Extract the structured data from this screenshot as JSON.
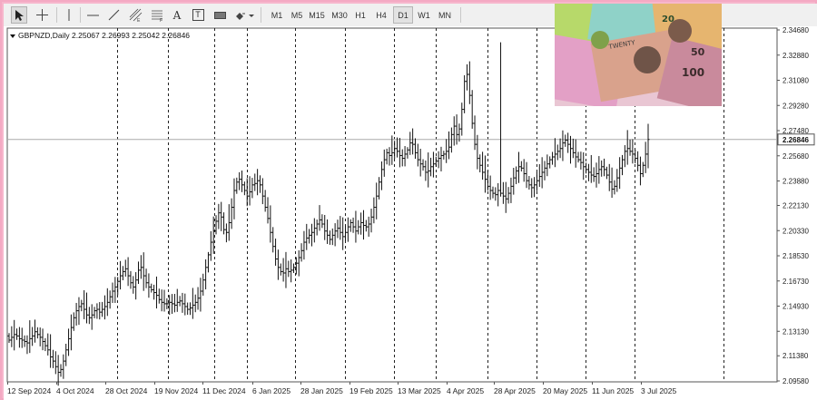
{
  "toolbar": {
    "tools": [
      {
        "name": "cursor-arrow-icon"
      },
      {
        "name": "crosshair-icon"
      },
      {
        "name": "vertical-line-icon"
      },
      {
        "name": "horizontal-line-icon"
      },
      {
        "name": "trendline-icon"
      },
      {
        "name": "equidistant-channel-icon"
      },
      {
        "name": "fibonacci-retracement-icon"
      },
      {
        "name": "text-tool-icon",
        "label": "A"
      },
      {
        "name": "text-label-icon",
        "label": "T"
      },
      {
        "name": "rectangle-icon"
      },
      {
        "name": "shapes-dropdown-icon"
      }
    ],
    "timeframes": [
      "M1",
      "M5",
      "M15",
      "M30",
      "H1",
      "H4",
      "D1",
      "W1",
      "MN"
    ],
    "active_timeframe": "D1"
  },
  "chart_header": {
    "symbol": "GBPNZD,Daily",
    "ohlc": "2.25067 2.26993 2.25042 2.26846"
  },
  "chart_data": {
    "type": "candlestick",
    "symbol": "GBPNZD",
    "timeframe": "Daily",
    "price_axis_labels": [
      "2.34680",
      "2.32880",
      "2.31080",
      "2.29280",
      "2.27480",
      "2.25680",
      "2.23880",
      "2.22130",
      "2.20330",
      "2.18530",
      "2.16730",
      "2.14930",
      "2.13130",
      "2.11380",
      "2.09580"
    ],
    "ylim": [
      2.0958,
      2.3468
    ],
    "current_price": "2.26846",
    "date_axis_labels": [
      "12 Sep 2024",
      "4 Oct 2024",
      "28 Oct 2024",
      "19 Nov 2024",
      "11 Dec 2024",
      "6 Jan 2025",
      "28 Jan 2025",
      "19 Feb 2025",
      "13 Mar 2025",
      "4 Apr 2025",
      "28 Apr 2025",
      "20 May 2025",
      "11 Jun 2025",
      "3 Jul 2025"
    ],
    "closes": [
      2.125,
      2.127,
      2.129,
      2.128,
      2.126,
      2.125,
      2.124,
      2.123,
      2.126,
      2.128,
      2.131,
      2.129,
      2.127,
      2.124,
      2.121,
      2.118,
      2.113,
      2.11,
      2.106,
      2.102,
      2.104,
      2.11,
      2.118,
      2.126,
      2.134,
      2.141,
      2.146,
      2.149,
      2.151,
      2.147,
      2.143,
      2.141,
      2.143,
      2.146,
      2.147,
      2.145,
      2.147,
      2.149,
      2.152,
      2.156,
      2.16,
      2.163,
      2.167,
      2.171,
      2.174,
      2.176,
      2.171,
      2.166,
      2.163,
      2.168,
      2.175,
      2.177,
      2.171,
      2.166,
      2.163,
      2.161,
      2.159,
      2.157,
      2.154,
      2.152,
      2.151,
      2.151,
      2.152,
      2.151,
      2.15,
      2.152,
      2.153,
      2.151,
      2.149,
      2.147,
      2.148,
      2.15,
      2.152,
      2.155,
      2.16,
      2.168,
      2.177,
      2.186,
      2.195,
      2.203,
      2.21,
      2.216,
      2.213,
      2.204,
      2.202,
      2.209,
      2.22,
      2.232,
      2.238,
      2.24,
      2.236,
      2.232,
      2.228,
      2.231,
      2.236,
      2.237,
      2.239,
      2.236,
      2.228,
      2.22,
      2.212,
      2.202,
      2.192,
      2.183,
      2.177,
      2.174,
      2.173,
      2.176,
      2.174,
      2.175,
      2.177,
      2.18,
      2.184,
      2.189,
      2.195,
      2.198,
      2.2,
      2.202,
      2.205,
      2.208,
      2.211,
      2.208,
      2.203,
      2.2,
      2.197,
      2.2,
      2.203,
      2.205,
      2.202,
      2.199,
      2.202,
      2.206,
      2.209,
      2.206,
      2.203,
      2.206,
      2.209,
      2.207,
      2.206,
      2.208,
      2.213,
      2.22,
      2.228,
      2.238,
      2.247,
      2.254,
      2.259,
      2.257,
      2.259,
      2.262,
      2.26,
      2.257,
      2.255,
      2.258,
      2.261,
      2.266,
      2.265,
      2.259,
      2.254,
      2.251,
      2.249,
      2.245,
      2.246,
      2.249,
      2.251,
      2.253,
      2.255,
      2.257,
      2.258,
      2.26,
      2.263,
      2.272,
      2.278,
      2.272,
      2.276,
      2.29,
      2.31,
      2.315,
      2.3,
      2.28,
      2.265,
      2.255,
      2.25,
      2.245,
      2.24,
      2.235,
      2.232,
      2.23,
      2.229,
      2.232,
      2.23,
      2.228,
      2.226,
      2.23,
      2.235,
      2.241,
      2.246,
      2.249,
      2.248,
      2.244,
      2.239,
      2.236,
      2.234,
      2.236,
      2.239,
      2.242,
      2.245,
      2.248,
      2.251,
      2.254,
      2.256,
      2.258,
      2.26,
      2.262,
      2.266,
      2.268,
      2.265,
      2.262,
      2.259,
      2.256,
      2.254,
      2.252,
      2.249,
      2.247,
      2.245,
      2.243,
      2.242,
      2.244,
      2.247,
      2.249,
      2.247,
      2.243,
      2.238,
      2.233,
      2.235,
      2.241,
      2.248,
      2.254,
      2.26,
      2.262,
      2.26,
      2.258,
      2.255,
      2.25,
      2.244,
      2.25,
      2.258,
      2.2685
    ]
  },
  "photo": {
    "alt_description_none": ""
  }
}
